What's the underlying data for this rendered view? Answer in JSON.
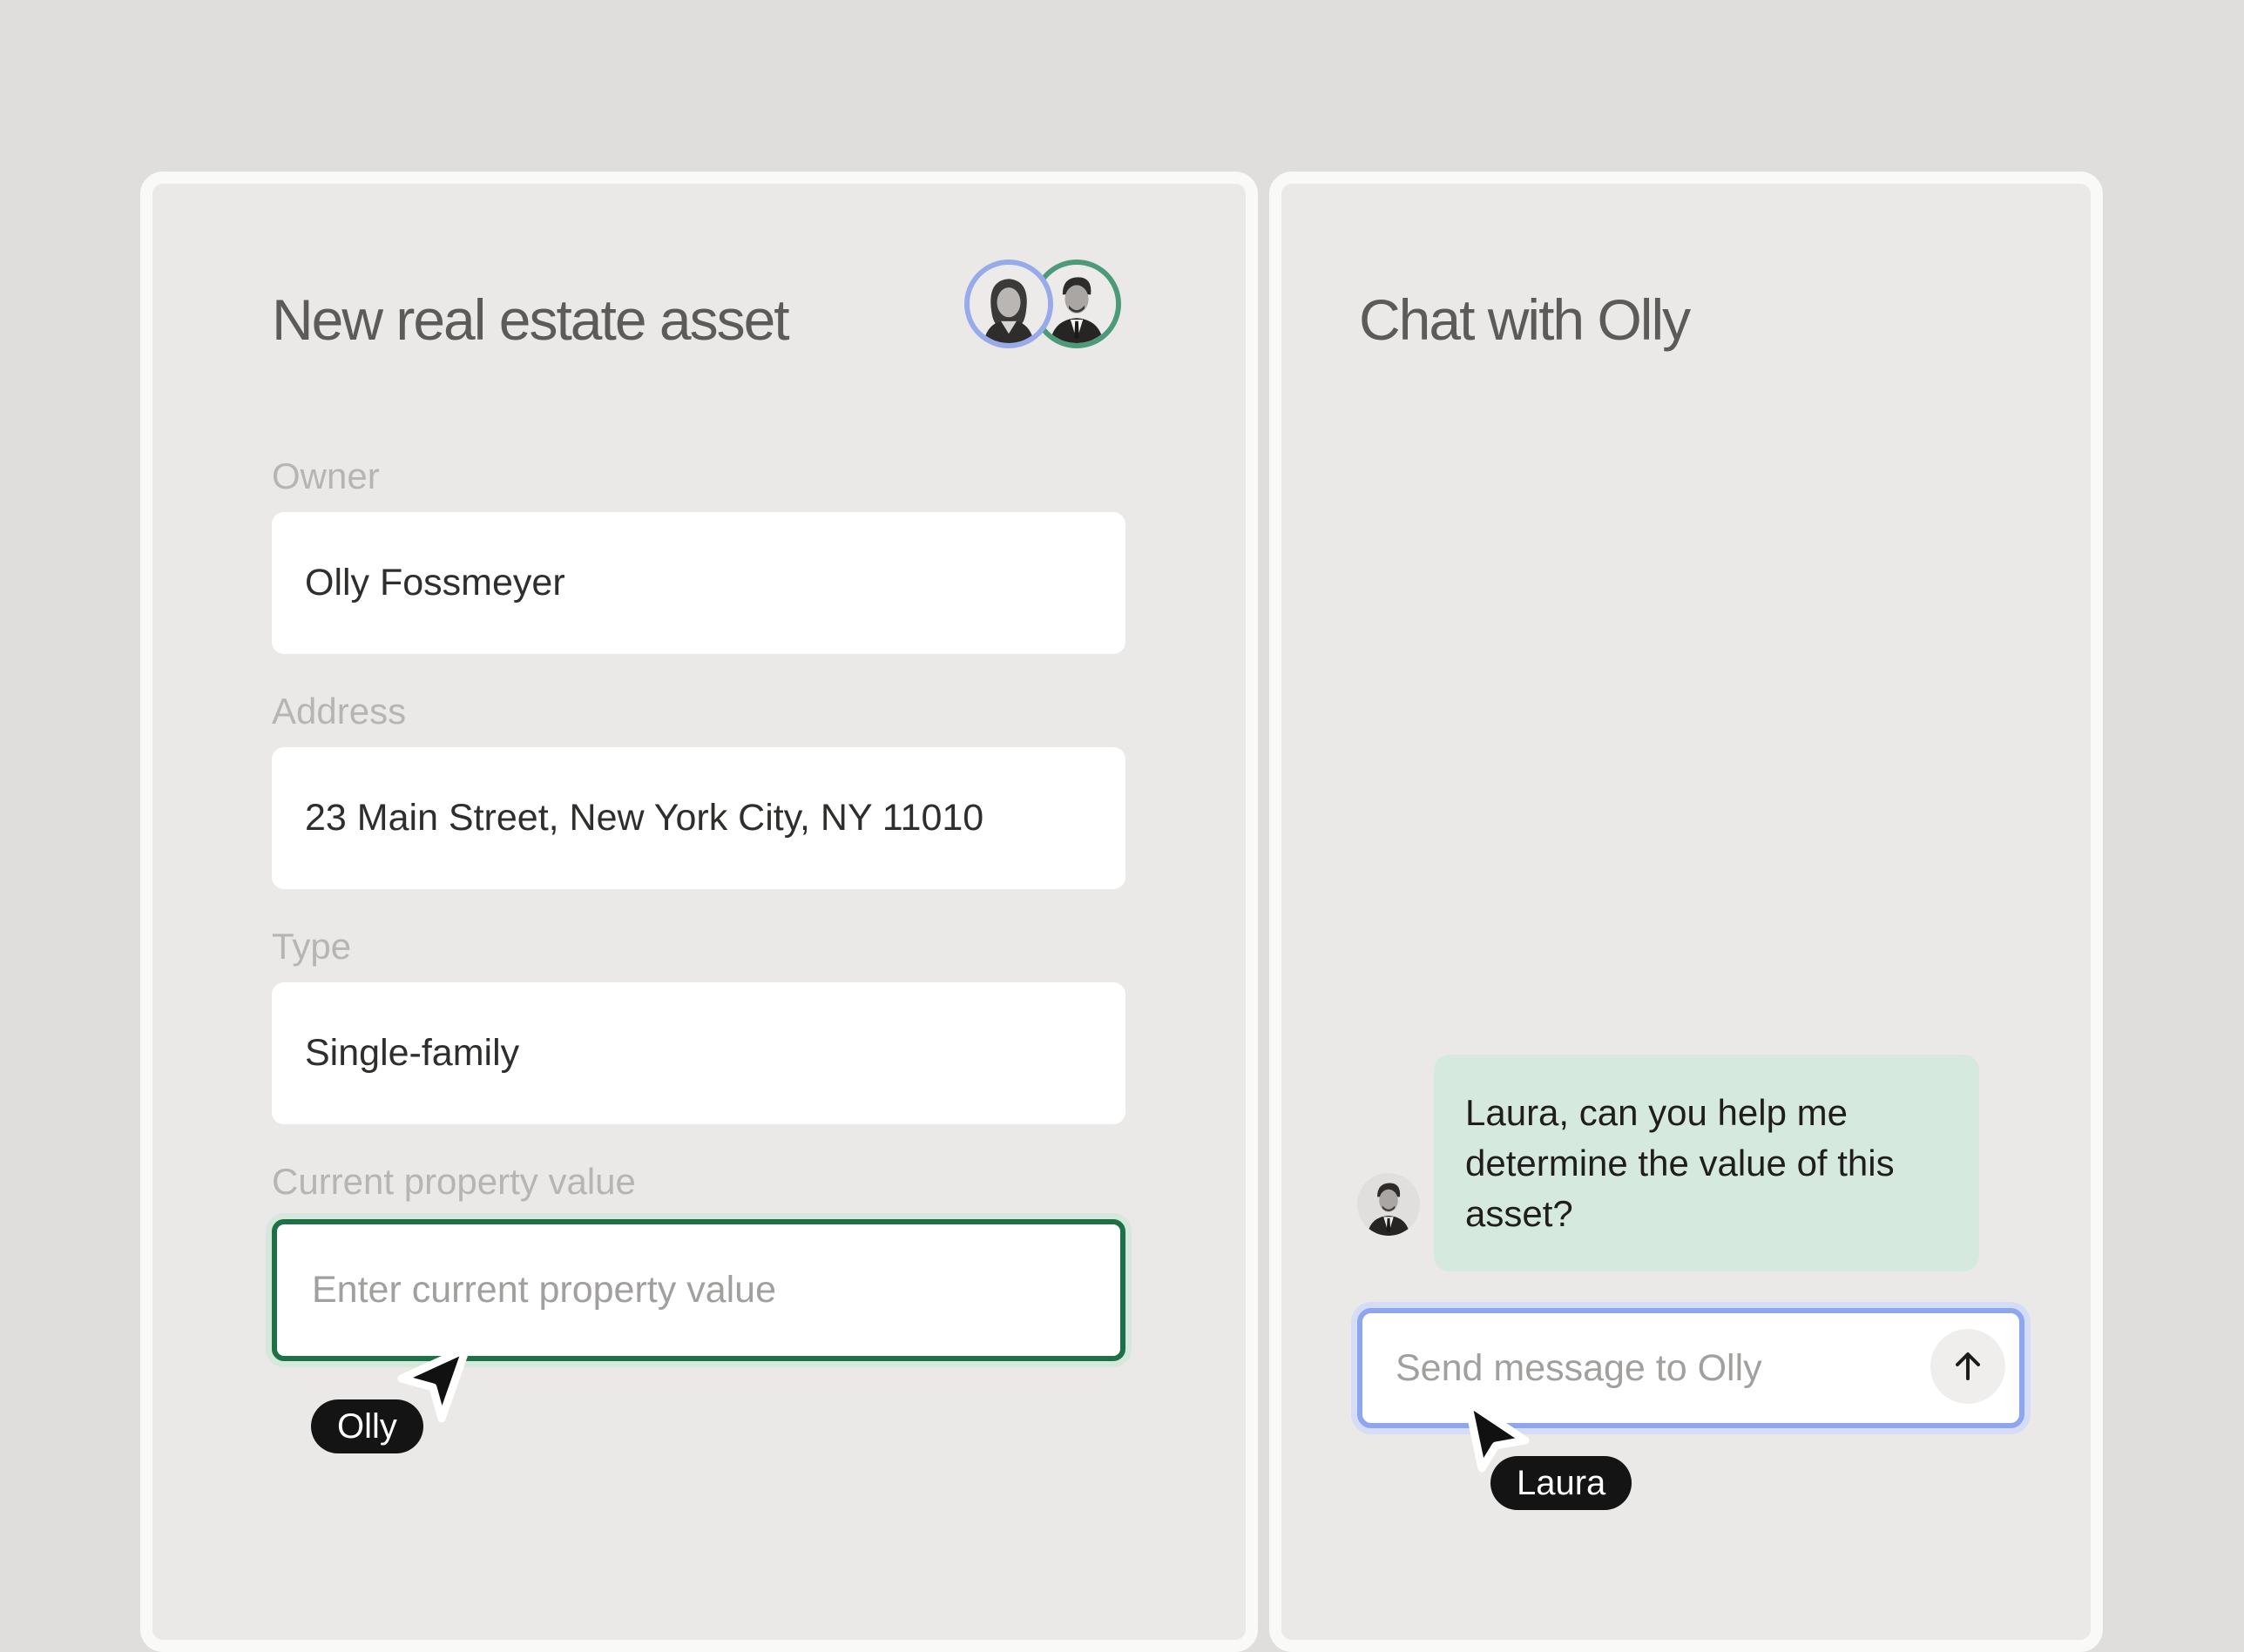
{
  "form": {
    "title": "New real estate asset",
    "collaborators": [
      "female-avatar",
      "male-avatar"
    ],
    "fields": [
      {
        "label": "Owner",
        "value": "Olly Fossmeyer"
      },
      {
        "label": "Address",
        "value": "23 Main Street, New York City, NY 11010"
      },
      {
        "label": "Type",
        "value": "Single-family"
      },
      {
        "label": "Current property value",
        "value": "",
        "placeholder": "Enter current property value"
      }
    ],
    "cursor_tag": "Olly"
  },
  "chat": {
    "title": "Chat with Olly",
    "message": "Laura, can you help me determine the value of this asset?",
    "input_placeholder": "Send message to Olly",
    "send_icon": "arrow-up-icon",
    "cursor_tag": "Laura"
  },
  "colors": {
    "background": "#dfdedd",
    "panel": "#ebe9e8",
    "focus_green": "#1e7146",
    "focus_blue": "#8ea6ee",
    "bubble_green": "#d5e9de",
    "avatar_ring_blue": "#97aaea",
    "avatar_ring_green": "#4d9a78"
  }
}
